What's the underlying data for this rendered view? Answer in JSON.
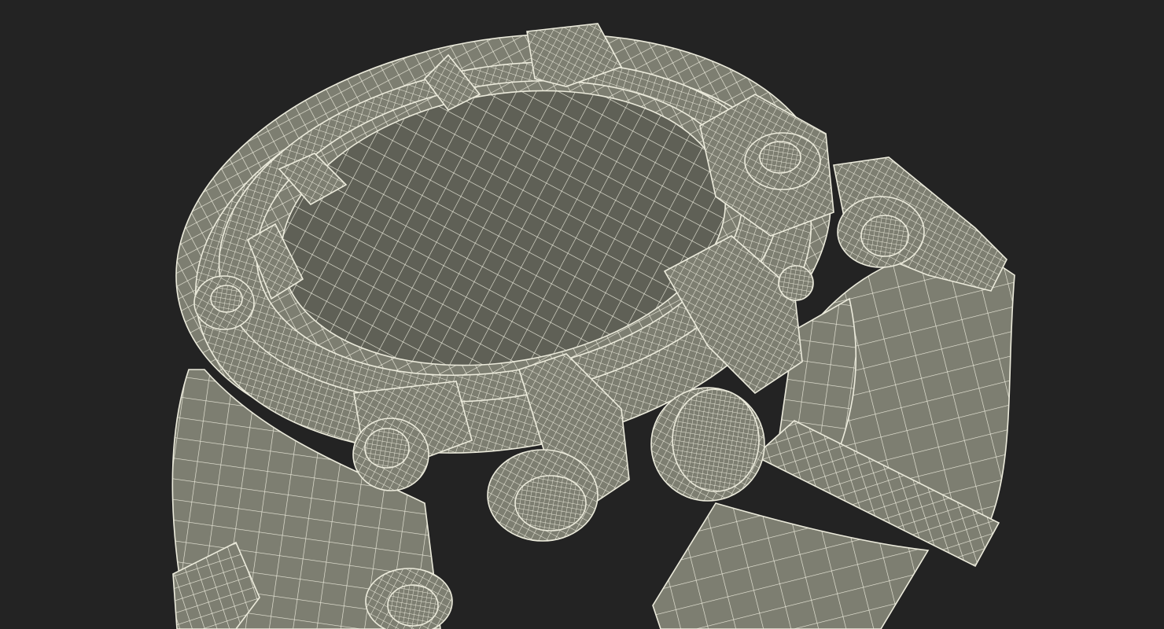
{
  "scene": {
    "subject": "wireframe-watch-model",
    "colors": {
      "background": "#232323",
      "surface": "#7d7e71",
      "surface_shadow": "#5f6056",
      "surface_light": "#8e8f81",
      "wire": "#ecebdc"
    }
  }
}
